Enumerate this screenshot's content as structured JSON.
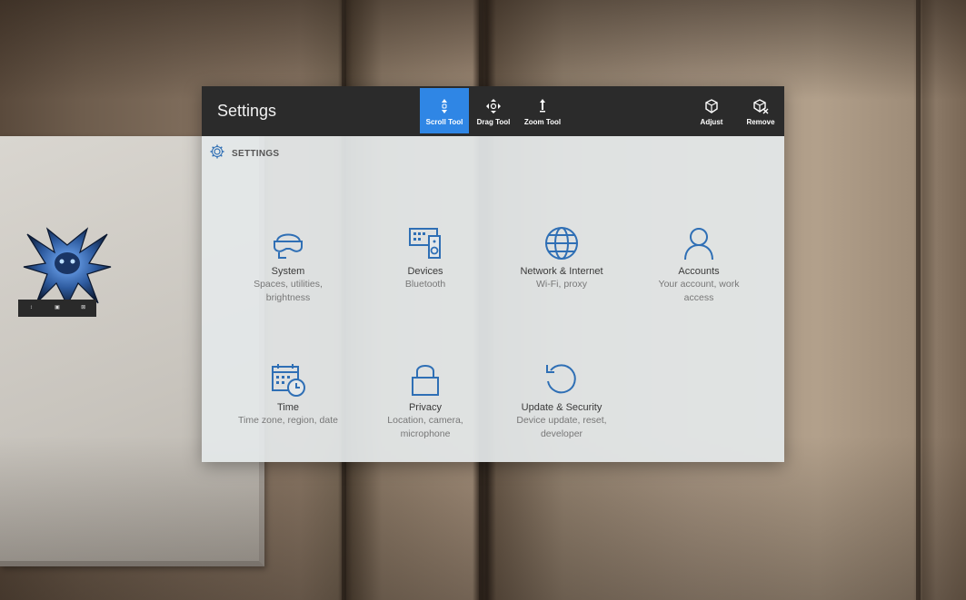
{
  "window": {
    "title": "Settings",
    "tools": [
      {
        "label": "Scroll Tool",
        "icon": "scroll-icon",
        "active": true
      },
      {
        "label": "Drag Tool",
        "icon": "drag-icon",
        "active": false
      },
      {
        "label": "Zoom Tool",
        "icon": "zoom-icon",
        "active": false
      }
    ],
    "actions": [
      {
        "label": "Adjust",
        "icon": "adjust-icon"
      },
      {
        "label": "Remove",
        "icon": "remove-icon"
      }
    ]
  },
  "breadcrumb": {
    "label": "SETTINGS",
    "icon": "gear-icon"
  },
  "tiles": [
    {
      "name": "System",
      "description": "Spaces, utilities, brightness",
      "icon": "hololens-icon"
    },
    {
      "name": "Devices",
      "description": "Bluetooth",
      "icon": "keyboard-speaker-icon"
    },
    {
      "name": "Network & Internet",
      "description": "Wi-Fi, proxy",
      "icon": "globe-icon"
    },
    {
      "name": "Accounts",
      "description": "Your account, work access",
      "icon": "person-icon"
    },
    {
      "name": "Time",
      "description": "Time zone, region, date",
      "icon": "calendar-clock-icon"
    },
    {
      "name": "Privacy",
      "description": "Location, camera, microphone",
      "icon": "lock-icon"
    },
    {
      "name": "Update & Security",
      "description": "Device update, reset, developer",
      "icon": "refresh-icon"
    }
  ],
  "colors": {
    "accent": "#2f86e5",
    "icon": "#2f6fb5",
    "titlebar": "#2b2b2b"
  }
}
